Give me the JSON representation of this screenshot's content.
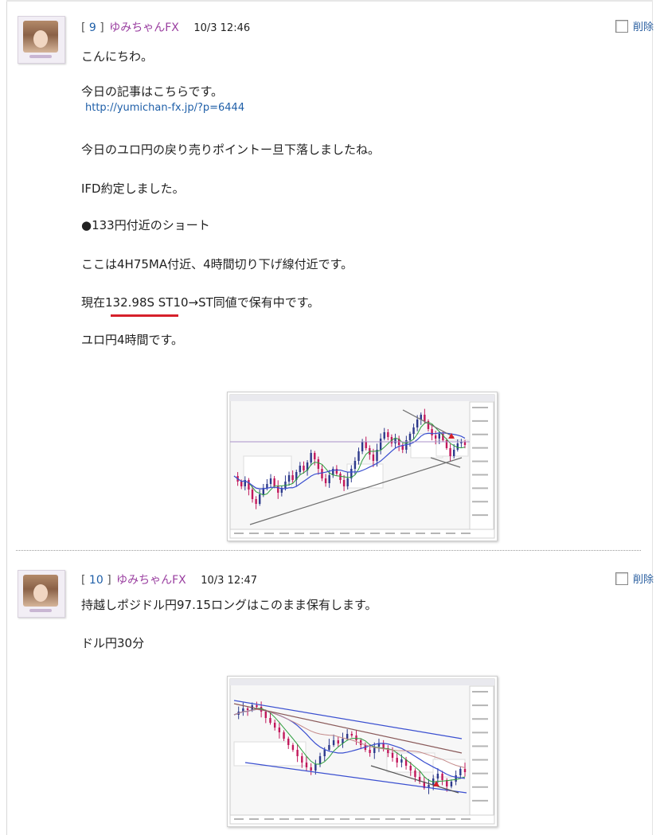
{
  "comments": [
    {
      "number": "9",
      "author": "ゆみちゃんFX",
      "time": "10/3 12:46",
      "delete_label": "削除",
      "lines": [
        "こんにちわ。",
        "今日の記事はこちらです。",
        "http://yumichan-fx.jp/?p=6444",
        "今日のユロ円の戻り売りポイントー旦下落しましたね。",
        "IFD約定しました。",
        "●133円付近のショート",
        "ここは4H75MA付近、4時間切り下げ線付近です。",
        "現在132.98S ST10→ST同値で保有中です。",
        "ユロ円4時間です。"
      ]
    },
    {
      "number": "10",
      "author": "ゆみちゃんFX",
      "time": "10/3 12:47",
      "delete_label": "削除",
      "lines": [
        "持越しポジドル円97.15ロングはこのまま保有します。",
        "ドル円30分"
      ]
    }
  ],
  "colors": {
    "link": "#1f5fa8",
    "author": "#9a3fa0",
    "highlight_underline": "#d6202a",
    "candle_up": "#2d3a8c",
    "candle_down": "#c2185b",
    "ma_fast": "#2e9e3e",
    "ma_slow": "#3a4fd0"
  }
}
